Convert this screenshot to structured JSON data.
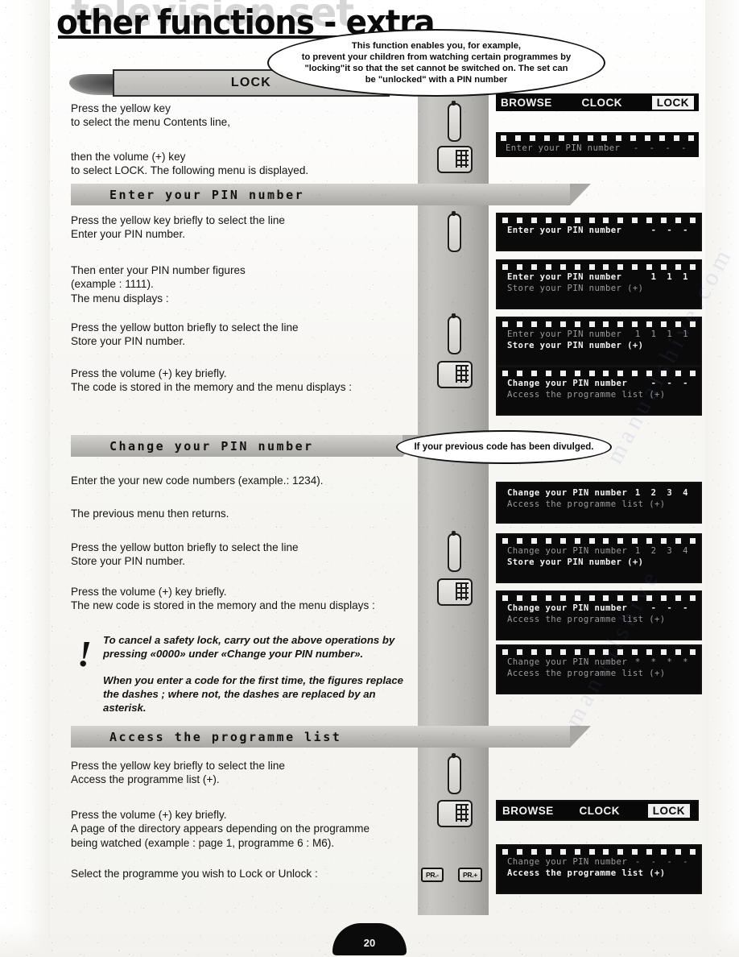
{
  "page": {
    "ghost_title": "television set",
    "title": "other functions - extra",
    "number": "20",
    "watermark": "manualshive.com",
    "watermark2": "manualshive"
  },
  "callouts": {
    "lock_bubble": "This function enables you, for example,\nto prevent your children from watching certain programmes by\n\"locking\"it so that the set cannot be switched on. The set can\nbe \"unlocked\" with a PIN number",
    "change_bubble": "If your previous code has been divulged."
  },
  "sections": [
    {
      "id": "lock",
      "banner": "LOCK",
      "paragraphs": [
        "Press the yellow key\nto select the menu Contents line,",
        "then the volume (+) key\nto select LOCK. The following menu is displayed."
      ]
    },
    {
      "id": "enter-pin",
      "banner": "Enter your PIN number",
      "paragraphs": [
        "Press the yellow key briefly to select the line\nEnter your PIN number.",
        "Then enter your PIN number figures\n(example : 1111).\nThe menu displays :",
        "Press the yellow button briefly to select the line\nStore your PIN number.",
        "Press the volume (+) key briefly.\nThe code is stored in the memory and the menu displays :"
      ]
    },
    {
      "id": "change-pin",
      "banner": "Change your PIN number",
      "paragraphs": [
        "Enter the your new code numbers (example.: 1234).",
        "The previous menu then returns.",
        "Press the yellow button briefly to select the line\nStore your PIN number.",
        "Press the volume (+) key briefly.\nThe new code is stored in the memory and the menu displays :"
      ]
    },
    {
      "id": "access-list",
      "banner": "Access the programme list",
      "paragraphs": [
        "Press the yellow key briefly to select the line\nAccess the programme list (+).",
        "Press the volume (+) key briefly.\nA page of the directory appears depending on the programme\nbeing watched (example : page 1, programme 6 : M6).",
        "Select the programme you wish to Lock or Unlock :"
      ]
    }
  ],
  "warning": {
    "mark": "!",
    "paragraph1": "To cancel a safety lock, carry out the above operations by\npressing «0000» under «Change your PIN number».",
    "paragraph2": "When you enter a code for the first time, the figures replace\nthe dashes ; where not, the dashes are replaced by an\nasterisk."
  },
  "remote_keys": {
    "yellow_key_name": "yellow-key",
    "volume_key_name": "volume-plus-key",
    "pr_minus": "PR.-",
    "pr_plus": "PR.+"
  },
  "osd": {
    "topbar": {
      "browse": "BROWSE",
      "clock": "CLOCK",
      "lock": "LOCK"
    },
    "screens": [
      {
        "id": "osd-1",
        "has_topbar": true,
        "lines": [
          {
            "label": "Enter your PIN number",
            "value": "- - - -",
            "style": "dim"
          }
        ]
      },
      {
        "id": "osd-2",
        "lines": [
          {
            "label": "Enter your PIN number",
            "value": "- - -",
            "style": "bright",
            "flash": true
          }
        ]
      },
      {
        "id": "osd-3",
        "lines": [
          {
            "label": "Enter your PIN number",
            "value": "1 1 1",
            "style": "bright",
            "flash": true
          },
          {
            "label": "Store your PIN number (+)",
            "value": "",
            "style": "dim"
          }
        ]
      },
      {
        "id": "osd-4",
        "lines": [
          {
            "label": "Enter your PIN number",
            "value": "1 1 1 1",
            "style": "dim"
          },
          {
            "label": "Store your PIN number (+)",
            "value": "",
            "style": "bright"
          }
        ]
      },
      {
        "id": "osd-5",
        "lines": [
          {
            "label": "Change your PIN number",
            "value": "- - -",
            "style": "bright",
            "flash": true
          },
          {
            "label": "Access the programme list (+)",
            "value": "",
            "style": "dim"
          }
        ]
      },
      {
        "id": "osd-6",
        "lines": [
          {
            "label": "Change your PIN number",
            "value": "1 2 3 4",
            "style": "bright"
          },
          {
            "label": "Access the programme list (+)",
            "value": "",
            "style": "dim"
          }
        ]
      },
      {
        "id": "osd-7",
        "lines": [
          {
            "label": "Change your PIN number",
            "value": "1 2 3 4",
            "style": "dim"
          },
          {
            "label": "Store your PIN number (+)",
            "value": "",
            "style": "bright"
          }
        ]
      },
      {
        "id": "osd-8",
        "lines": [
          {
            "label": "Change your PIN number",
            "value": "- - -",
            "style": "bright",
            "flash": true
          },
          {
            "label": "Access the programme list (+)",
            "value": "",
            "style": "dim"
          }
        ]
      },
      {
        "id": "osd-9",
        "lines": [
          {
            "label": "Change your PIN number",
            "value": "* * * *",
            "style": "dim"
          },
          {
            "label": "Access the programme list (+)",
            "value": "",
            "style": "dim"
          }
        ]
      },
      {
        "id": "osd-10",
        "has_topbar": true,
        "topbar_bracketed": true,
        "lines": []
      },
      {
        "id": "osd-11",
        "lines": [
          {
            "label": "Change your PIN number",
            "value": "- - - -",
            "style": "dim"
          },
          {
            "label": "Access the programme list (+)",
            "value": "",
            "style": "bright"
          }
        ]
      }
    ]
  }
}
